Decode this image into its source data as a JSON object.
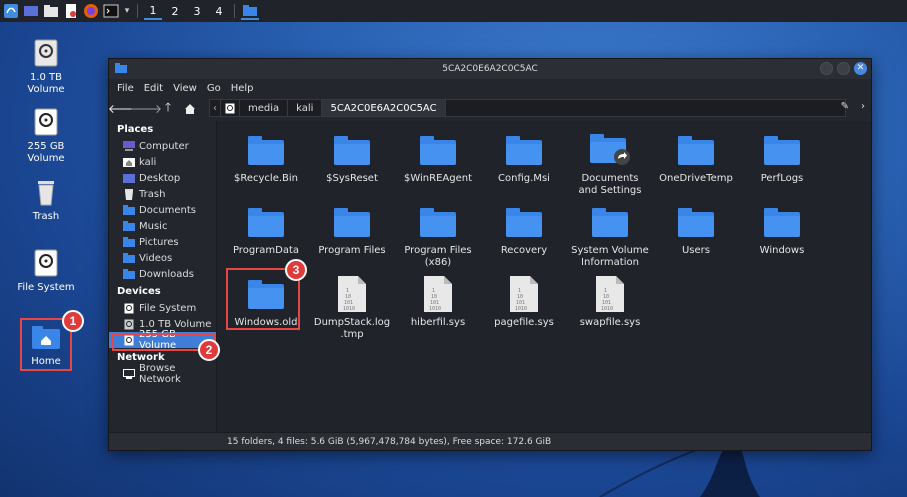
{
  "panel": {
    "workspaces": [
      "1",
      "2",
      "3",
      "4"
    ]
  },
  "desktop": {
    "icons": [
      {
        "label": "1.0 TB\nVolume",
        "icon": "drive-icon"
      },
      {
        "label": "255 GB\nVolume",
        "icon": "drive-icon"
      },
      {
        "label": "Trash",
        "icon": "trash-icon"
      },
      {
        "label": "File System",
        "icon": "drive-icon"
      },
      {
        "label": "Home",
        "icon": "home-icon"
      }
    ]
  },
  "window": {
    "title": "5CA2C0E6A2C0C5AC",
    "menu": [
      "File",
      "Edit",
      "View",
      "Go",
      "Help"
    ],
    "breadcrumb": [
      "media",
      "kali",
      "5CA2C0E6A2C0C5AC"
    ],
    "sidebar": {
      "places_title": "Places",
      "places": [
        "Computer",
        "kali",
        "Desktop",
        "Trash",
        "Documents",
        "Music",
        "Pictures",
        "Videos",
        "Downloads"
      ],
      "devices_title": "Devices",
      "devices": [
        "File System",
        "1.0 TB Volume",
        "255 GB Volume"
      ],
      "network_title": "Network",
      "network": [
        "Browse Network"
      ]
    },
    "files": [
      {
        "name": "$Recycle.Bin",
        "type": "folder"
      },
      {
        "name": "$SysReset",
        "type": "folder"
      },
      {
        "name": "$WinREAgent",
        "type": "folder"
      },
      {
        "name": "Config.Msi",
        "type": "folder"
      },
      {
        "name": "Documents and Settings",
        "type": "folder-link"
      },
      {
        "name": "OneDriveTemp",
        "type": "folder"
      },
      {
        "name": "PerfLogs",
        "type": "folder"
      },
      {
        "name": "ProgramData",
        "type": "folder"
      },
      {
        "name": "Program Files",
        "type": "folder"
      },
      {
        "name": "Program Files (x86)",
        "type": "folder"
      },
      {
        "name": "Recovery",
        "type": "folder"
      },
      {
        "name": "System Volume Information",
        "type": "folder"
      },
      {
        "name": "Users",
        "type": "folder"
      },
      {
        "name": "Windows",
        "type": "folder"
      },
      {
        "name": "Windows.old",
        "type": "folder"
      },
      {
        "name": "DumpStack.log.tmp",
        "type": "binary"
      },
      {
        "name": "hiberfil.sys",
        "type": "binary"
      },
      {
        "name": "pagefile.sys",
        "type": "binary"
      },
      {
        "name": "swapfile.sys",
        "type": "binary"
      }
    ],
    "status": "15 folders, 4 files: 5.6 GiB (5,967,478,784 bytes), Free space: 172.6 GiB"
  },
  "annotations": [
    "1",
    "2",
    "3"
  ],
  "colors": {
    "accent": "#3e7dd8",
    "folder": "#3a86e8",
    "highlight": "#e84545"
  }
}
